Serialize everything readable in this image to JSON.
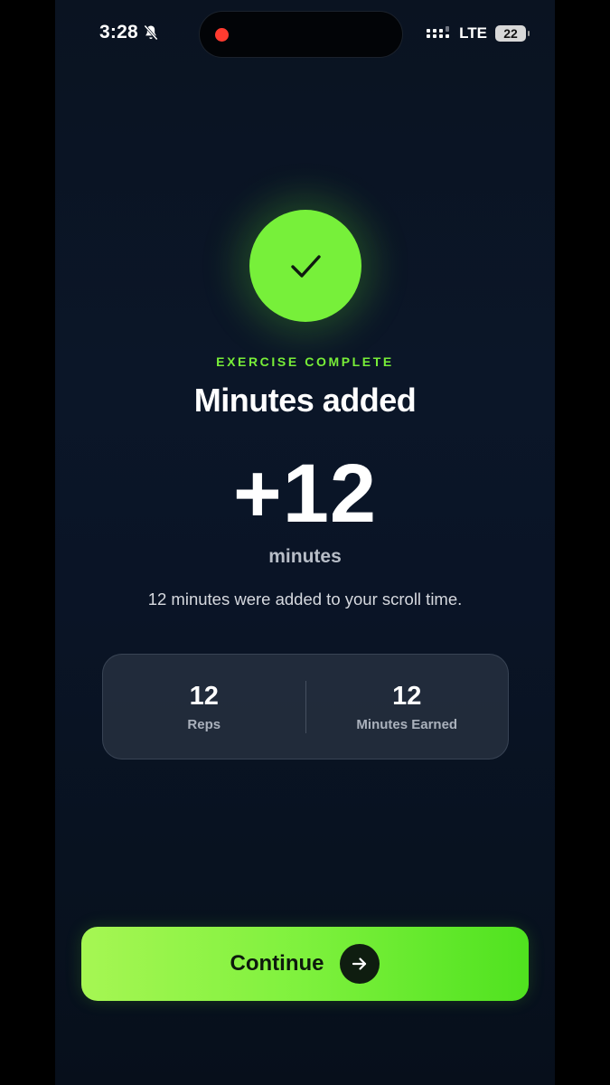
{
  "status_bar": {
    "time": "3:28",
    "network": "LTE",
    "battery": "22",
    "icons": {
      "silent": "bell-slash-icon",
      "signal": "signal-bars-icon",
      "recording": "recording-dot"
    }
  },
  "result": {
    "icon": "checkmark-icon",
    "eyebrow": "EXERCISE COMPLETE",
    "title": "Minutes added",
    "amount": "+12",
    "unit": "minutes",
    "description": "12 minutes were added to your scroll time."
  },
  "stats": [
    {
      "value": "12",
      "label": "Reps"
    },
    {
      "value": "12",
      "label": "Minutes Earned"
    }
  ],
  "continue_button": {
    "label": "Continue",
    "icon": "arrow-right-icon"
  },
  "colors": {
    "accent_green": "#77f03a",
    "background": "#0b1628",
    "card": "#2b3444"
  }
}
